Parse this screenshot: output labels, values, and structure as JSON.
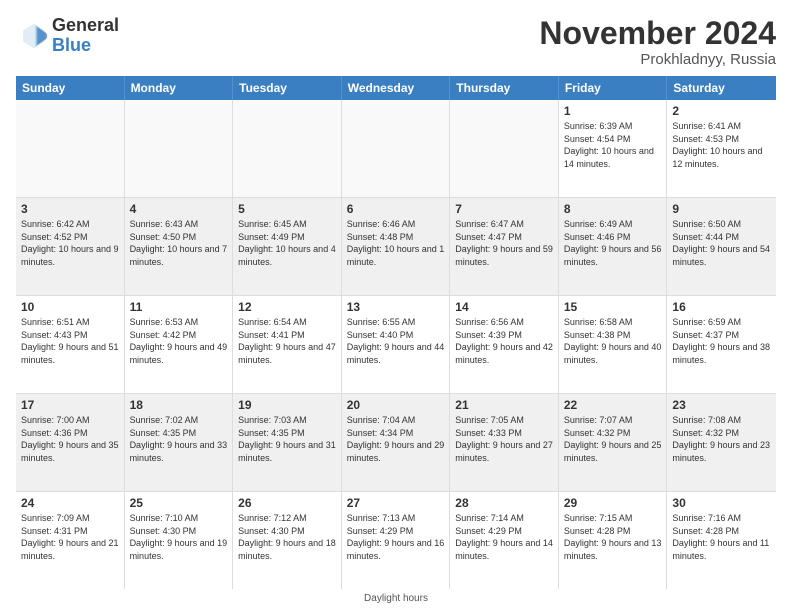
{
  "logo": {
    "general": "General",
    "blue": "Blue"
  },
  "title": "November 2024",
  "location": "Prokhladnyy, Russia",
  "days_header": [
    "Sunday",
    "Monday",
    "Tuesday",
    "Wednesday",
    "Thursday",
    "Friday",
    "Saturday"
  ],
  "footer": "Daylight hours",
  "weeks": [
    [
      {
        "day": "",
        "info": ""
      },
      {
        "day": "",
        "info": ""
      },
      {
        "day": "",
        "info": ""
      },
      {
        "day": "",
        "info": ""
      },
      {
        "day": "",
        "info": ""
      },
      {
        "day": "1",
        "info": "Sunrise: 6:39 AM\nSunset: 4:54 PM\nDaylight: 10 hours and 14 minutes."
      },
      {
        "day": "2",
        "info": "Sunrise: 6:41 AM\nSunset: 4:53 PM\nDaylight: 10 hours and 12 minutes."
      }
    ],
    [
      {
        "day": "3",
        "info": "Sunrise: 6:42 AM\nSunset: 4:52 PM\nDaylight: 10 hours and 9 minutes."
      },
      {
        "day": "4",
        "info": "Sunrise: 6:43 AM\nSunset: 4:50 PM\nDaylight: 10 hours and 7 minutes."
      },
      {
        "day": "5",
        "info": "Sunrise: 6:45 AM\nSunset: 4:49 PM\nDaylight: 10 hours and 4 minutes."
      },
      {
        "day": "6",
        "info": "Sunrise: 6:46 AM\nSunset: 4:48 PM\nDaylight: 10 hours and 1 minute."
      },
      {
        "day": "7",
        "info": "Sunrise: 6:47 AM\nSunset: 4:47 PM\nDaylight: 9 hours and 59 minutes."
      },
      {
        "day": "8",
        "info": "Sunrise: 6:49 AM\nSunset: 4:46 PM\nDaylight: 9 hours and 56 minutes."
      },
      {
        "day": "9",
        "info": "Sunrise: 6:50 AM\nSunset: 4:44 PM\nDaylight: 9 hours and 54 minutes."
      }
    ],
    [
      {
        "day": "10",
        "info": "Sunrise: 6:51 AM\nSunset: 4:43 PM\nDaylight: 9 hours and 51 minutes."
      },
      {
        "day": "11",
        "info": "Sunrise: 6:53 AM\nSunset: 4:42 PM\nDaylight: 9 hours and 49 minutes."
      },
      {
        "day": "12",
        "info": "Sunrise: 6:54 AM\nSunset: 4:41 PM\nDaylight: 9 hours and 47 minutes."
      },
      {
        "day": "13",
        "info": "Sunrise: 6:55 AM\nSunset: 4:40 PM\nDaylight: 9 hours and 44 minutes."
      },
      {
        "day": "14",
        "info": "Sunrise: 6:56 AM\nSunset: 4:39 PM\nDaylight: 9 hours and 42 minutes."
      },
      {
        "day": "15",
        "info": "Sunrise: 6:58 AM\nSunset: 4:38 PM\nDaylight: 9 hours and 40 minutes."
      },
      {
        "day": "16",
        "info": "Sunrise: 6:59 AM\nSunset: 4:37 PM\nDaylight: 9 hours and 38 minutes."
      }
    ],
    [
      {
        "day": "17",
        "info": "Sunrise: 7:00 AM\nSunset: 4:36 PM\nDaylight: 9 hours and 35 minutes."
      },
      {
        "day": "18",
        "info": "Sunrise: 7:02 AM\nSunset: 4:35 PM\nDaylight: 9 hours and 33 minutes."
      },
      {
        "day": "19",
        "info": "Sunrise: 7:03 AM\nSunset: 4:35 PM\nDaylight: 9 hours and 31 minutes."
      },
      {
        "day": "20",
        "info": "Sunrise: 7:04 AM\nSunset: 4:34 PM\nDaylight: 9 hours and 29 minutes."
      },
      {
        "day": "21",
        "info": "Sunrise: 7:05 AM\nSunset: 4:33 PM\nDaylight: 9 hours and 27 minutes."
      },
      {
        "day": "22",
        "info": "Sunrise: 7:07 AM\nSunset: 4:32 PM\nDaylight: 9 hours and 25 minutes."
      },
      {
        "day": "23",
        "info": "Sunrise: 7:08 AM\nSunset: 4:32 PM\nDaylight: 9 hours and 23 minutes."
      }
    ],
    [
      {
        "day": "24",
        "info": "Sunrise: 7:09 AM\nSunset: 4:31 PM\nDaylight: 9 hours and 21 minutes."
      },
      {
        "day": "25",
        "info": "Sunrise: 7:10 AM\nSunset: 4:30 PM\nDaylight: 9 hours and 19 minutes."
      },
      {
        "day": "26",
        "info": "Sunrise: 7:12 AM\nSunset: 4:30 PM\nDaylight: 9 hours and 18 minutes."
      },
      {
        "day": "27",
        "info": "Sunrise: 7:13 AM\nSunset: 4:29 PM\nDaylight: 9 hours and 16 minutes."
      },
      {
        "day": "28",
        "info": "Sunrise: 7:14 AM\nSunset: 4:29 PM\nDaylight: 9 hours and 14 minutes."
      },
      {
        "day": "29",
        "info": "Sunrise: 7:15 AM\nSunset: 4:28 PM\nDaylight: 9 hours and 13 minutes."
      },
      {
        "day": "30",
        "info": "Sunrise: 7:16 AM\nSunset: 4:28 PM\nDaylight: 9 hours and 11 minutes."
      }
    ]
  ]
}
